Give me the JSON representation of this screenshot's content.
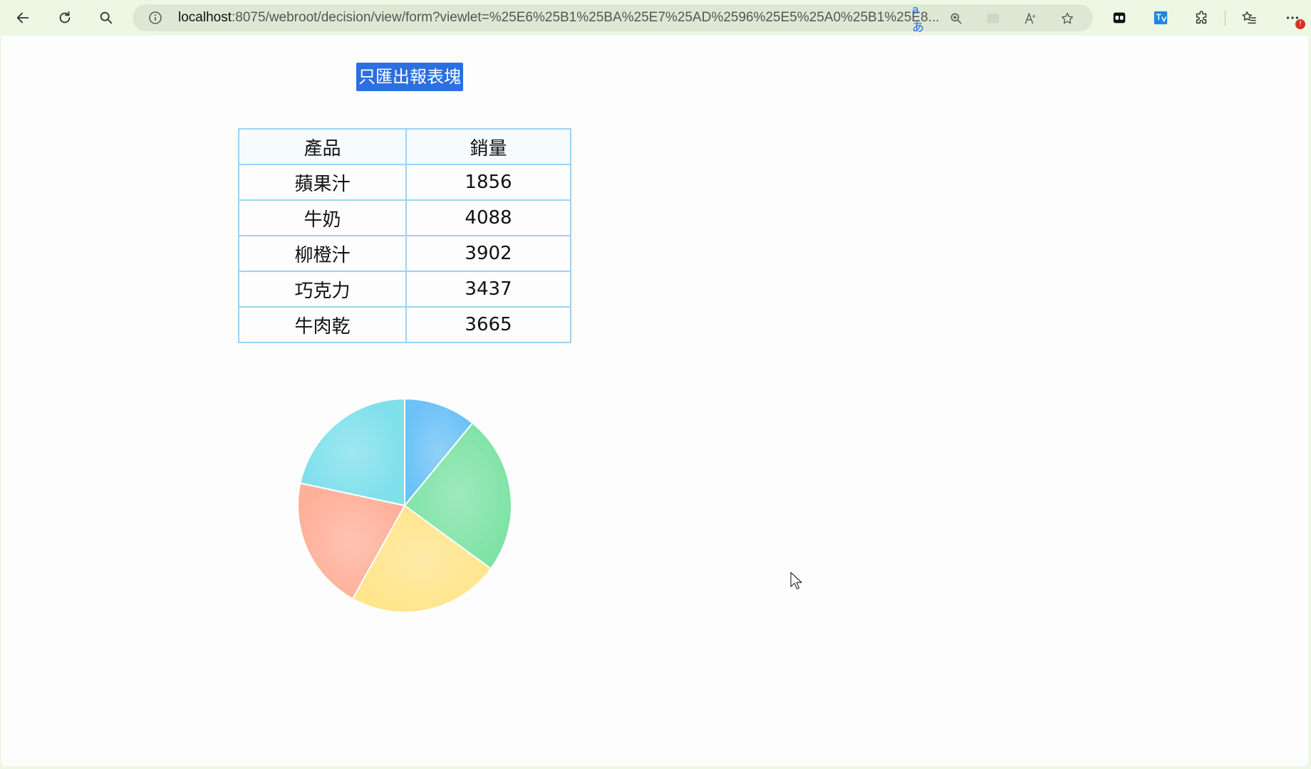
{
  "browser": {
    "url_host": "localhost",
    "url_rest": ":8075/webroot/decision/view/form?viewlet=%25E6%25B1%25BA%25E7%25AD%2596%25E5%25A0%25B1%25E8...",
    "translate_label": "aあ",
    "notification_badge": "!"
  },
  "page": {
    "export_button_label": "只匯出報表塊",
    "table": {
      "headers": [
        "產品",
        "銷量"
      ],
      "rows": [
        {
          "product": "蘋果汁",
          "sales": "1856"
        },
        {
          "product": "牛奶",
          "sales": "4088"
        },
        {
          "product": "柳橙汁",
          "sales": "3902"
        },
        {
          "product": "巧克力",
          "sales": "3437"
        },
        {
          "product": "牛肉乾",
          "sales": "3665"
        }
      ]
    }
  },
  "chart_data": {
    "type": "pie",
    "categories": [
      "蘋果汁",
      "牛奶",
      "柳橙汁",
      "巧克力",
      "牛肉乾"
    ],
    "values": [
      1856,
      4088,
      3902,
      3437,
      3665
    ],
    "colors": [
      "#6cc2f7",
      "#7fe3a6",
      "#ffe58c",
      "#ffb09a",
      "#7fe0ec"
    ],
    "legend": "none",
    "labels_shown": false
  }
}
